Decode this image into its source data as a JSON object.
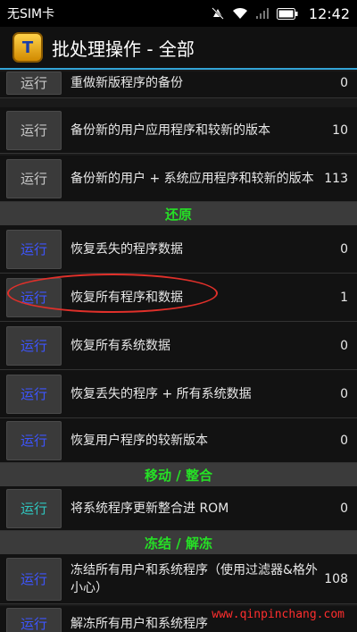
{
  "status_bar": {
    "carrier": "无SIM卡",
    "time": "12:42"
  },
  "action_bar": {
    "title": "批处理操作 - 全部",
    "icon_letter": "T"
  },
  "run_label": "运行",
  "rows_top": [
    {
      "label": "重做新版程序的备份",
      "count": "0"
    },
    {
      "label": "备份新的用户应用程序和较新的版本",
      "count": "10"
    },
    {
      "label": "备份新的用户 + 系统应用程序和较新的版本",
      "count": "113"
    }
  ],
  "sections": {
    "restore": "还原",
    "move": "移动 / 整合",
    "freeze": "冻结 / 解冻"
  },
  "rows_restore": [
    {
      "label": "恢复丢失的程序数据",
      "count": "0"
    },
    {
      "label": "恢复所有程序和数据",
      "count": "1"
    },
    {
      "label": "恢复所有系统数据",
      "count": "0"
    },
    {
      "label": "恢复丢失的程序 + 所有系统数据",
      "count": "0"
    },
    {
      "label": "恢复用户程序的较新版本",
      "count": "0"
    }
  ],
  "rows_move": [
    {
      "label": "将系统程序更新整合进 ROM",
      "count": "0"
    }
  ],
  "rows_freeze": [
    {
      "label": "冻结所有用户和系统程序（使用过滤器&格外小心）",
      "count": "108"
    },
    {
      "label": "解冻所有用户和系统程序",
      "count": ""
    }
  ],
  "watermark": "www.qinpinchang.com",
  "colors": {
    "accent": "#33a4d6",
    "section_text": "#26e026",
    "run_blue": "#3d55ff",
    "run_teal": "#2fc7c0",
    "annotation": "#e0302a"
  }
}
